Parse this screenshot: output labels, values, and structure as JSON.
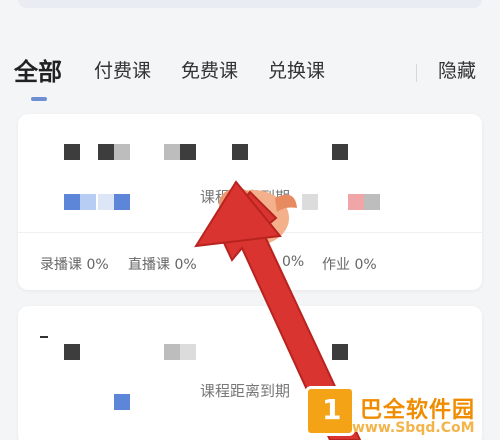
{
  "tabs": {
    "items": [
      {
        "label": "全部",
        "active": true
      },
      {
        "label": "付费课",
        "active": false
      },
      {
        "label": "免费课",
        "active": false
      },
      {
        "label": "兑换课",
        "active": false
      }
    ],
    "hidden_label": "隐藏",
    "accent_color": "#6f8fd3"
  },
  "course_card_1": {
    "expire_text": "课程距离到期",
    "stats": [
      {
        "label": "录播课 0%"
      },
      {
        "label": "直播课 0%"
      },
      {
        "label": "0%"
      },
      {
        "label": "作业 0%"
      }
    ]
  },
  "course_card_2": {
    "expire_text": "课程距离到期"
  },
  "overlay": {
    "arrow_color": "#d9342f",
    "watermark": {
      "logo_text": "1",
      "title": "巴全软件园",
      "subtitle": "www.Sbqd.CoM"
    }
  }
}
